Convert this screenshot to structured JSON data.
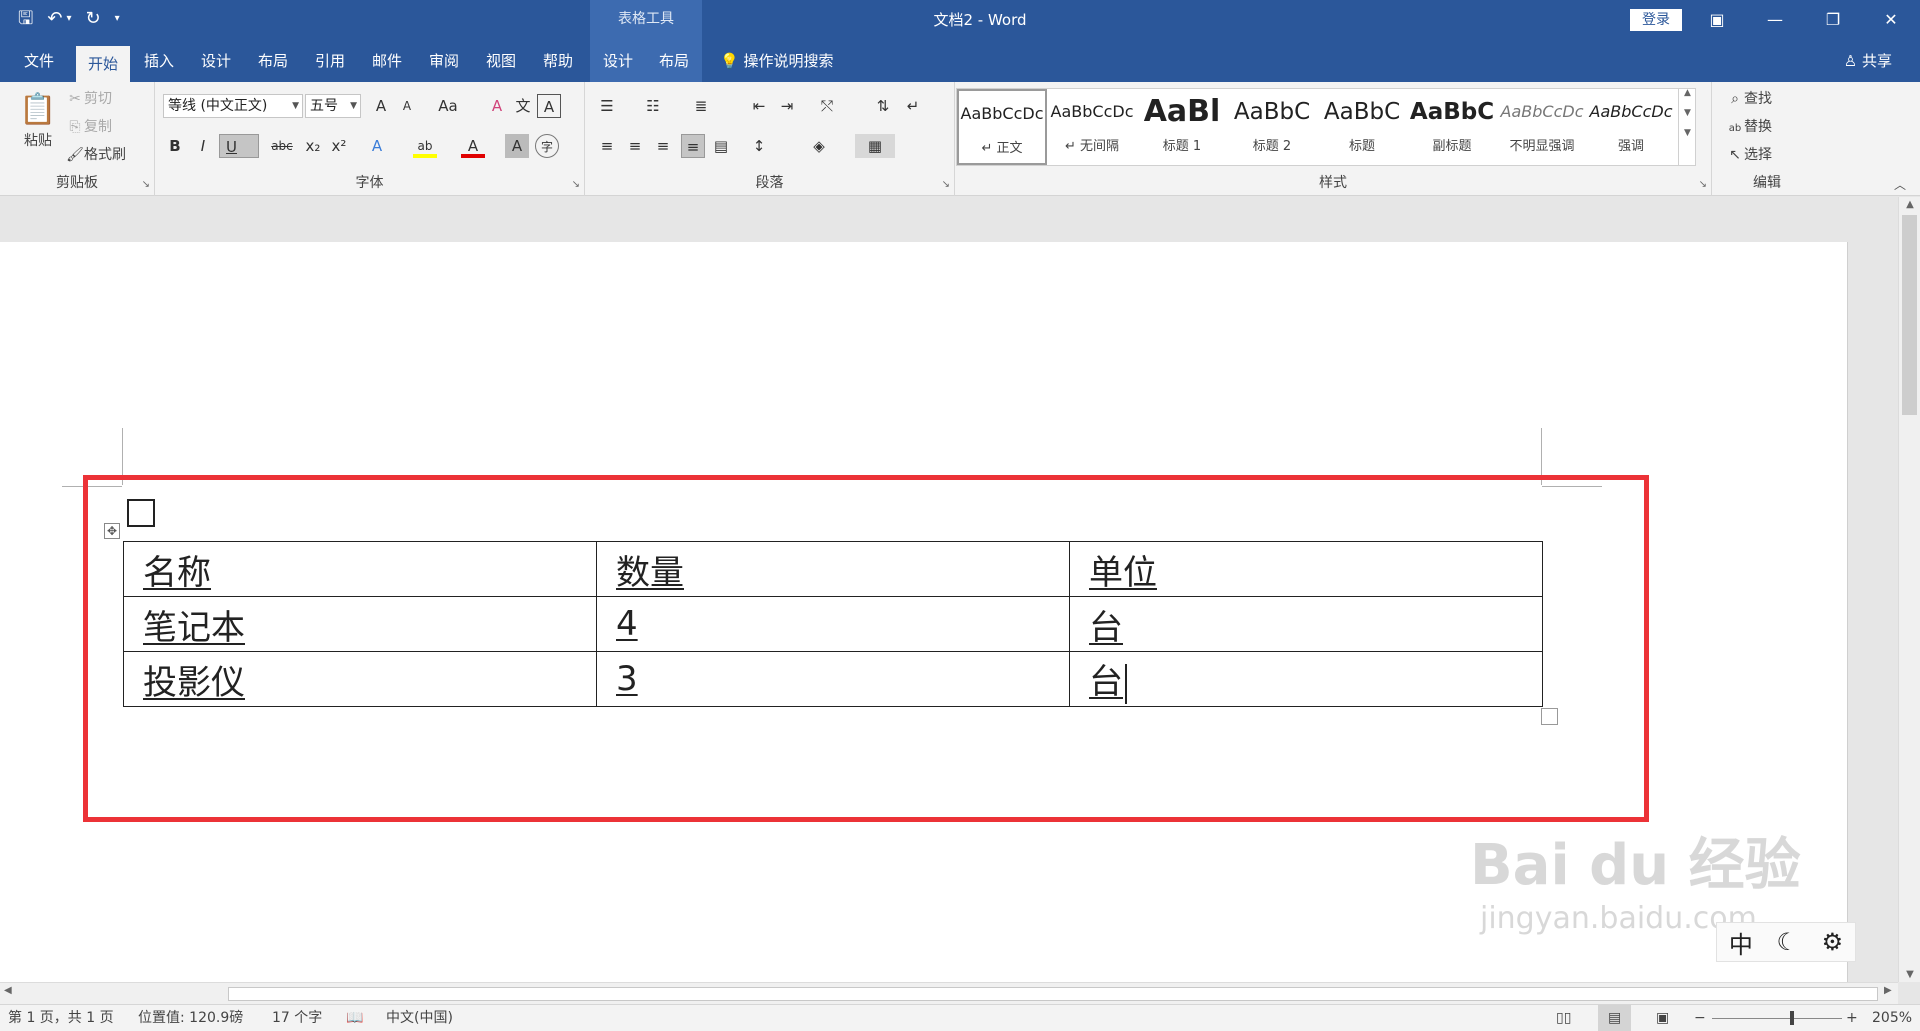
{
  "titlebar": {
    "qat": {
      "save": "🖫",
      "undo": "↶",
      "undo_drop": "▾",
      "redo": "↻",
      "customize": "▾"
    },
    "context_header": "表格工具",
    "title": "文档2 - Word",
    "login": "登录",
    "win_ribbon_options": "▣",
    "win_minimize": "—",
    "win_restore": "❐",
    "win_close": "✕"
  },
  "tabs": {
    "file": "文件",
    "home": "开始",
    "insert": "插入",
    "design": "设计",
    "layout": "布局",
    "references": "引用",
    "mailings": "邮件",
    "review": "审阅",
    "view": "视图",
    "help": "帮助",
    "table_design": "设计",
    "table_layout": "布局",
    "search": "操作说明搜索",
    "share": "共享"
  },
  "clipboard": {
    "paste": "粘贴",
    "cut": "剪切",
    "copy": "复制",
    "format_painter": "格式刷",
    "label": "剪贴板"
  },
  "font": {
    "name": "等线 (中文正文)",
    "size": "五号",
    "label": "字体",
    "grow": "A",
    "shrink": "A",
    "change_case": "Aa",
    "clear": "A",
    "pinyin": "文",
    "border": "A",
    "bold": "B",
    "italic": "I",
    "underline": "U",
    "strike": "abc",
    "subscript": "x₂",
    "superscript": "x²",
    "effects": "A",
    "highlight": "ab",
    "color": "A",
    "shading": "A",
    "enclose": "字"
  },
  "paragraph": {
    "label": "段落"
  },
  "styles": {
    "label": "样式",
    "items": [
      {
        "sample": "AaBbCcDc",
        "name": "↵ 正文"
      },
      {
        "sample": "AaBbCcDc",
        "name": "↵ 无间隔"
      },
      {
        "sample": "AaBl",
        "name": "标题 1"
      },
      {
        "sample": "AaBbC",
        "name": "标题 2"
      },
      {
        "sample": "AaBbC",
        "name": "标题"
      },
      {
        "sample": "AaBbC",
        "name": "副标题"
      },
      {
        "sample": "AaBbCcDc",
        "name": "不明显强调"
      },
      {
        "sample": "AaBbCcDc",
        "name": "强调"
      }
    ]
  },
  "editing": {
    "find": "查找",
    "replace": "替换",
    "select": "选择",
    "label": "编辑"
  },
  "document": {
    "table": [
      [
        "名称",
        "数量",
        "单位"
      ],
      [
        "笔记本",
        "4",
        "台"
      ],
      [
        "投影仪",
        "3",
        "台"
      ]
    ]
  },
  "ime": {
    "mode": "中",
    "moon": "☾",
    "settings": "⚙"
  },
  "watermark": {
    "logo": "Bai du 经验",
    "url": "jingyan.baidu.com"
  },
  "statusbar": {
    "page": "第 1 页，共 1 页",
    "position": "位置值: 120.9磅",
    "words": "17 个字",
    "language": "中文(中国)",
    "zoom": "205%"
  },
  "colors": {
    "accent": "#2b579a",
    "highlight_border": "#ec3237"
  }
}
